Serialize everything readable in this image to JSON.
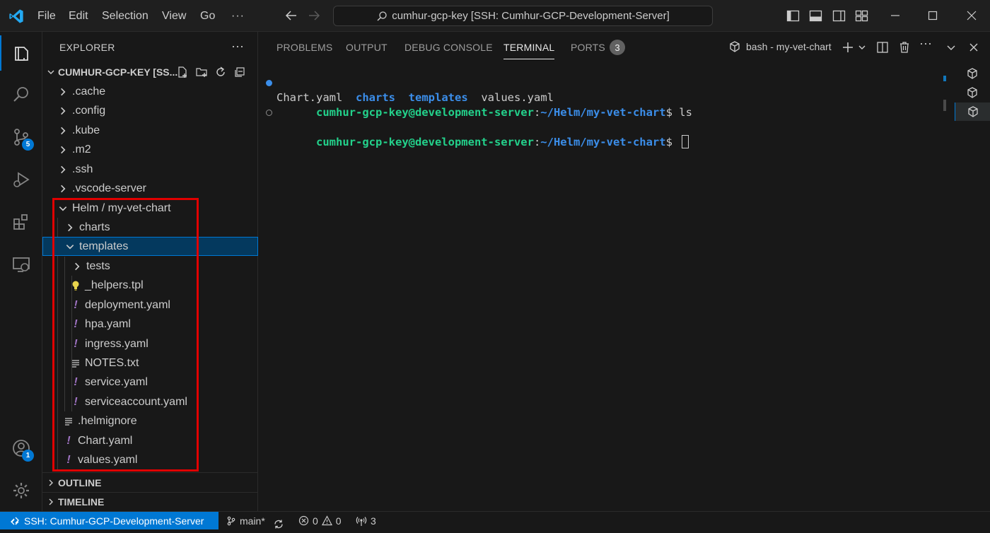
{
  "titlebar": {
    "menu": [
      "File",
      "Edit",
      "Selection",
      "View",
      "Go"
    ],
    "more": "···",
    "command_center": "cumhur-gcp-key [SSH: Cumhur-GCP-Development-Server]"
  },
  "activity_bar": {
    "source_control_badge": "5",
    "accounts_badge": "1"
  },
  "explorer": {
    "header": "EXPLORER",
    "more": "···",
    "root_title": "CUMHUR-GCP-KEY [SS...",
    "items": [
      {
        "label": ".cache",
        "kind": "folder",
        "expanded": false
      },
      {
        "label": ".config",
        "kind": "folder",
        "expanded": false
      },
      {
        "label": ".kube",
        "kind": "folder",
        "expanded": false
      },
      {
        "label": ".m2",
        "kind": "folder",
        "expanded": false
      },
      {
        "label": ".ssh",
        "kind": "folder",
        "expanded": false
      },
      {
        "label": ".vscode-server",
        "kind": "folder",
        "expanded": false
      },
      {
        "label": "Helm / my-vet-chart",
        "kind": "folder",
        "expanded": true
      },
      {
        "label": "charts",
        "kind": "folder",
        "expanded": false
      },
      {
        "label": "templates",
        "kind": "folder",
        "expanded": true,
        "selected": true
      },
      {
        "label": "tests",
        "kind": "folder",
        "expanded": false
      },
      {
        "label": "_helpers.tpl",
        "kind": "tpl"
      },
      {
        "label": "deployment.yaml",
        "kind": "yaml"
      },
      {
        "label": "hpa.yaml",
        "kind": "yaml"
      },
      {
        "label": "ingress.yaml",
        "kind": "yaml"
      },
      {
        "label": "NOTES.txt",
        "kind": "txt"
      },
      {
        "label": "service.yaml",
        "kind": "yaml"
      },
      {
        "label": "serviceaccount.yaml",
        "kind": "yaml"
      },
      {
        "label": ".helmignore",
        "kind": "txt"
      },
      {
        "label": "Chart.yaml",
        "kind": "yaml"
      },
      {
        "label": "values.yaml",
        "kind": "yaml"
      }
    ],
    "outline": "OUTLINE",
    "timeline": "TIMELINE"
  },
  "panel": {
    "tabs": [
      "PROBLEMS",
      "OUTPUT",
      "DEBUG CONSOLE",
      "TERMINAL",
      "PORTS"
    ],
    "active_tab": "TERMINAL",
    "ports_count": "3",
    "terminal_name": "bash - my-vet-chart",
    "lines": [
      {
        "user": "cumhur-gcp-key@development-server",
        "sep": ":",
        "path": "~/Helm/my-vet-chart",
        "prompt": "$ ",
        "cmd": "ls"
      },
      {
        "output": [
          {
            "text": "Chart.yaml",
            "type": "file"
          },
          {
            "text": "charts",
            "type": "dir"
          },
          {
            "text": "templates",
            "type": "dir"
          },
          {
            "text": "values.yaml",
            "type": "file"
          }
        ]
      },
      {
        "user": "cumhur-gcp-key@development-server",
        "sep": ":",
        "path": "~/Helm/my-vet-chart",
        "prompt": "$ ",
        "cmd": ""
      }
    ]
  },
  "statusbar": {
    "remote": "SSH: Cumhur-GCP-Development-Server",
    "branch": "main*",
    "errors": "0",
    "warnings": "0",
    "ports": "3"
  },
  "colors": {
    "accent": "#0078d4",
    "highlight_box": "#e00000",
    "terminal_user": "#23d18b",
    "terminal_path": "#3b8eea"
  }
}
